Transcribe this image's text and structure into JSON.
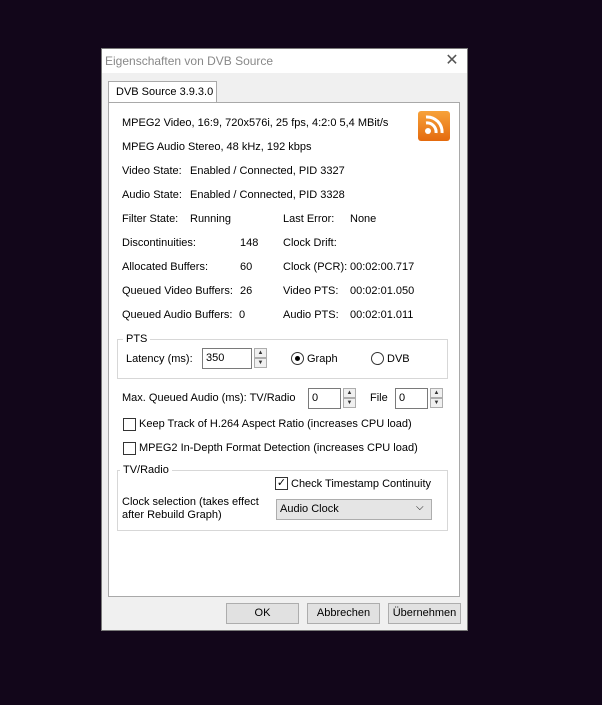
{
  "window": {
    "title": "Eigenschaften von DVB Source",
    "close_icon": "close-icon"
  },
  "tab": {
    "label": "DVB Source 3.9.3.0"
  },
  "info": {
    "video_line": "MPEG2 Video, 16:9, 720x576i, 25 fps, 4:2:0   5,4 MBit/s",
    "audio_line": "MPEG Audio Stereo, 48 kHz, 192 kbps",
    "video_state_label": "Video State:",
    "video_state_value": "Enabled / Connected, PID 3327",
    "audio_state_label": "Audio State:",
    "audio_state_value": "Enabled / Connected, PID 3328"
  },
  "stats": {
    "filter_state_label": "Filter State:",
    "filter_state_value": "Running",
    "last_error_label": "Last Error:",
    "last_error_value": "None",
    "discontinuities_label": "Discontinuities:",
    "discontinuities_value": "148",
    "clock_drift_label": "Clock Drift:",
    "allocated_buffers_label": "Allocated Buffers:",
    "allocated_buffers_value": "60",
    "clock_pcr_label": "Clock (PCR):",
    "clock_pcr_value": "00:02:00.717",
    "queued_video_label": "Queued Video Buffers:",
    "queued_video_value": "26",
    "video_pts_label": "Video PTS:",
    "video_pts_value": "00:02:01.050",
    "queued_audio_label": "Queued Audio Buffers:",
    "queued_audio_value": "0",
    "audio_pts_label": "Audio PTS:",
    "audio_pts_value": "00:02:01.011"
  },
  "pts": {
    "group_title": "PTS",
    "latency_label": "Latency (ms):",
    "latency_value": "350",
    "graph_label": "Graph",
    "dvb_label": "DVB",
    "selected": "Graph"
  },
  "queue": {
    "label": "Max. Queued Audio (ms): TV/Radio",
    "tv_radio_value": "0",
    "file_label": "File",
    "file_value": "0"
  },
  "options": {
    "h264_label": "Keep Track of H.264 Aspect Ratio (increases CPU load)",
    "h264_checked": false,
    "mpeg2_label": "MPEG2 In-Depth Format Detection (increases CPU load)",
    "mpeg2_checked": false
  },
  "tvradio": {
    "group_title": "TV/Radio",
    "timestamp_label": "Check Timestamp Continuity",
    "timestamp_checked": true,
    "clock_selection_label_1": "Clock selection (takes effect",
    "clock_selection_label_2": "after Rebuild Graph)",
    "clock_value": "Audio Clock"
  },
  "buttons": {
    "ok": "OK",
    "cancel": "Abbrechen",
    "apply": "Übernehmen"
  },
  "colors": {
    "logo": "#f08a24",
    "background": "#12061a"
  }
}
